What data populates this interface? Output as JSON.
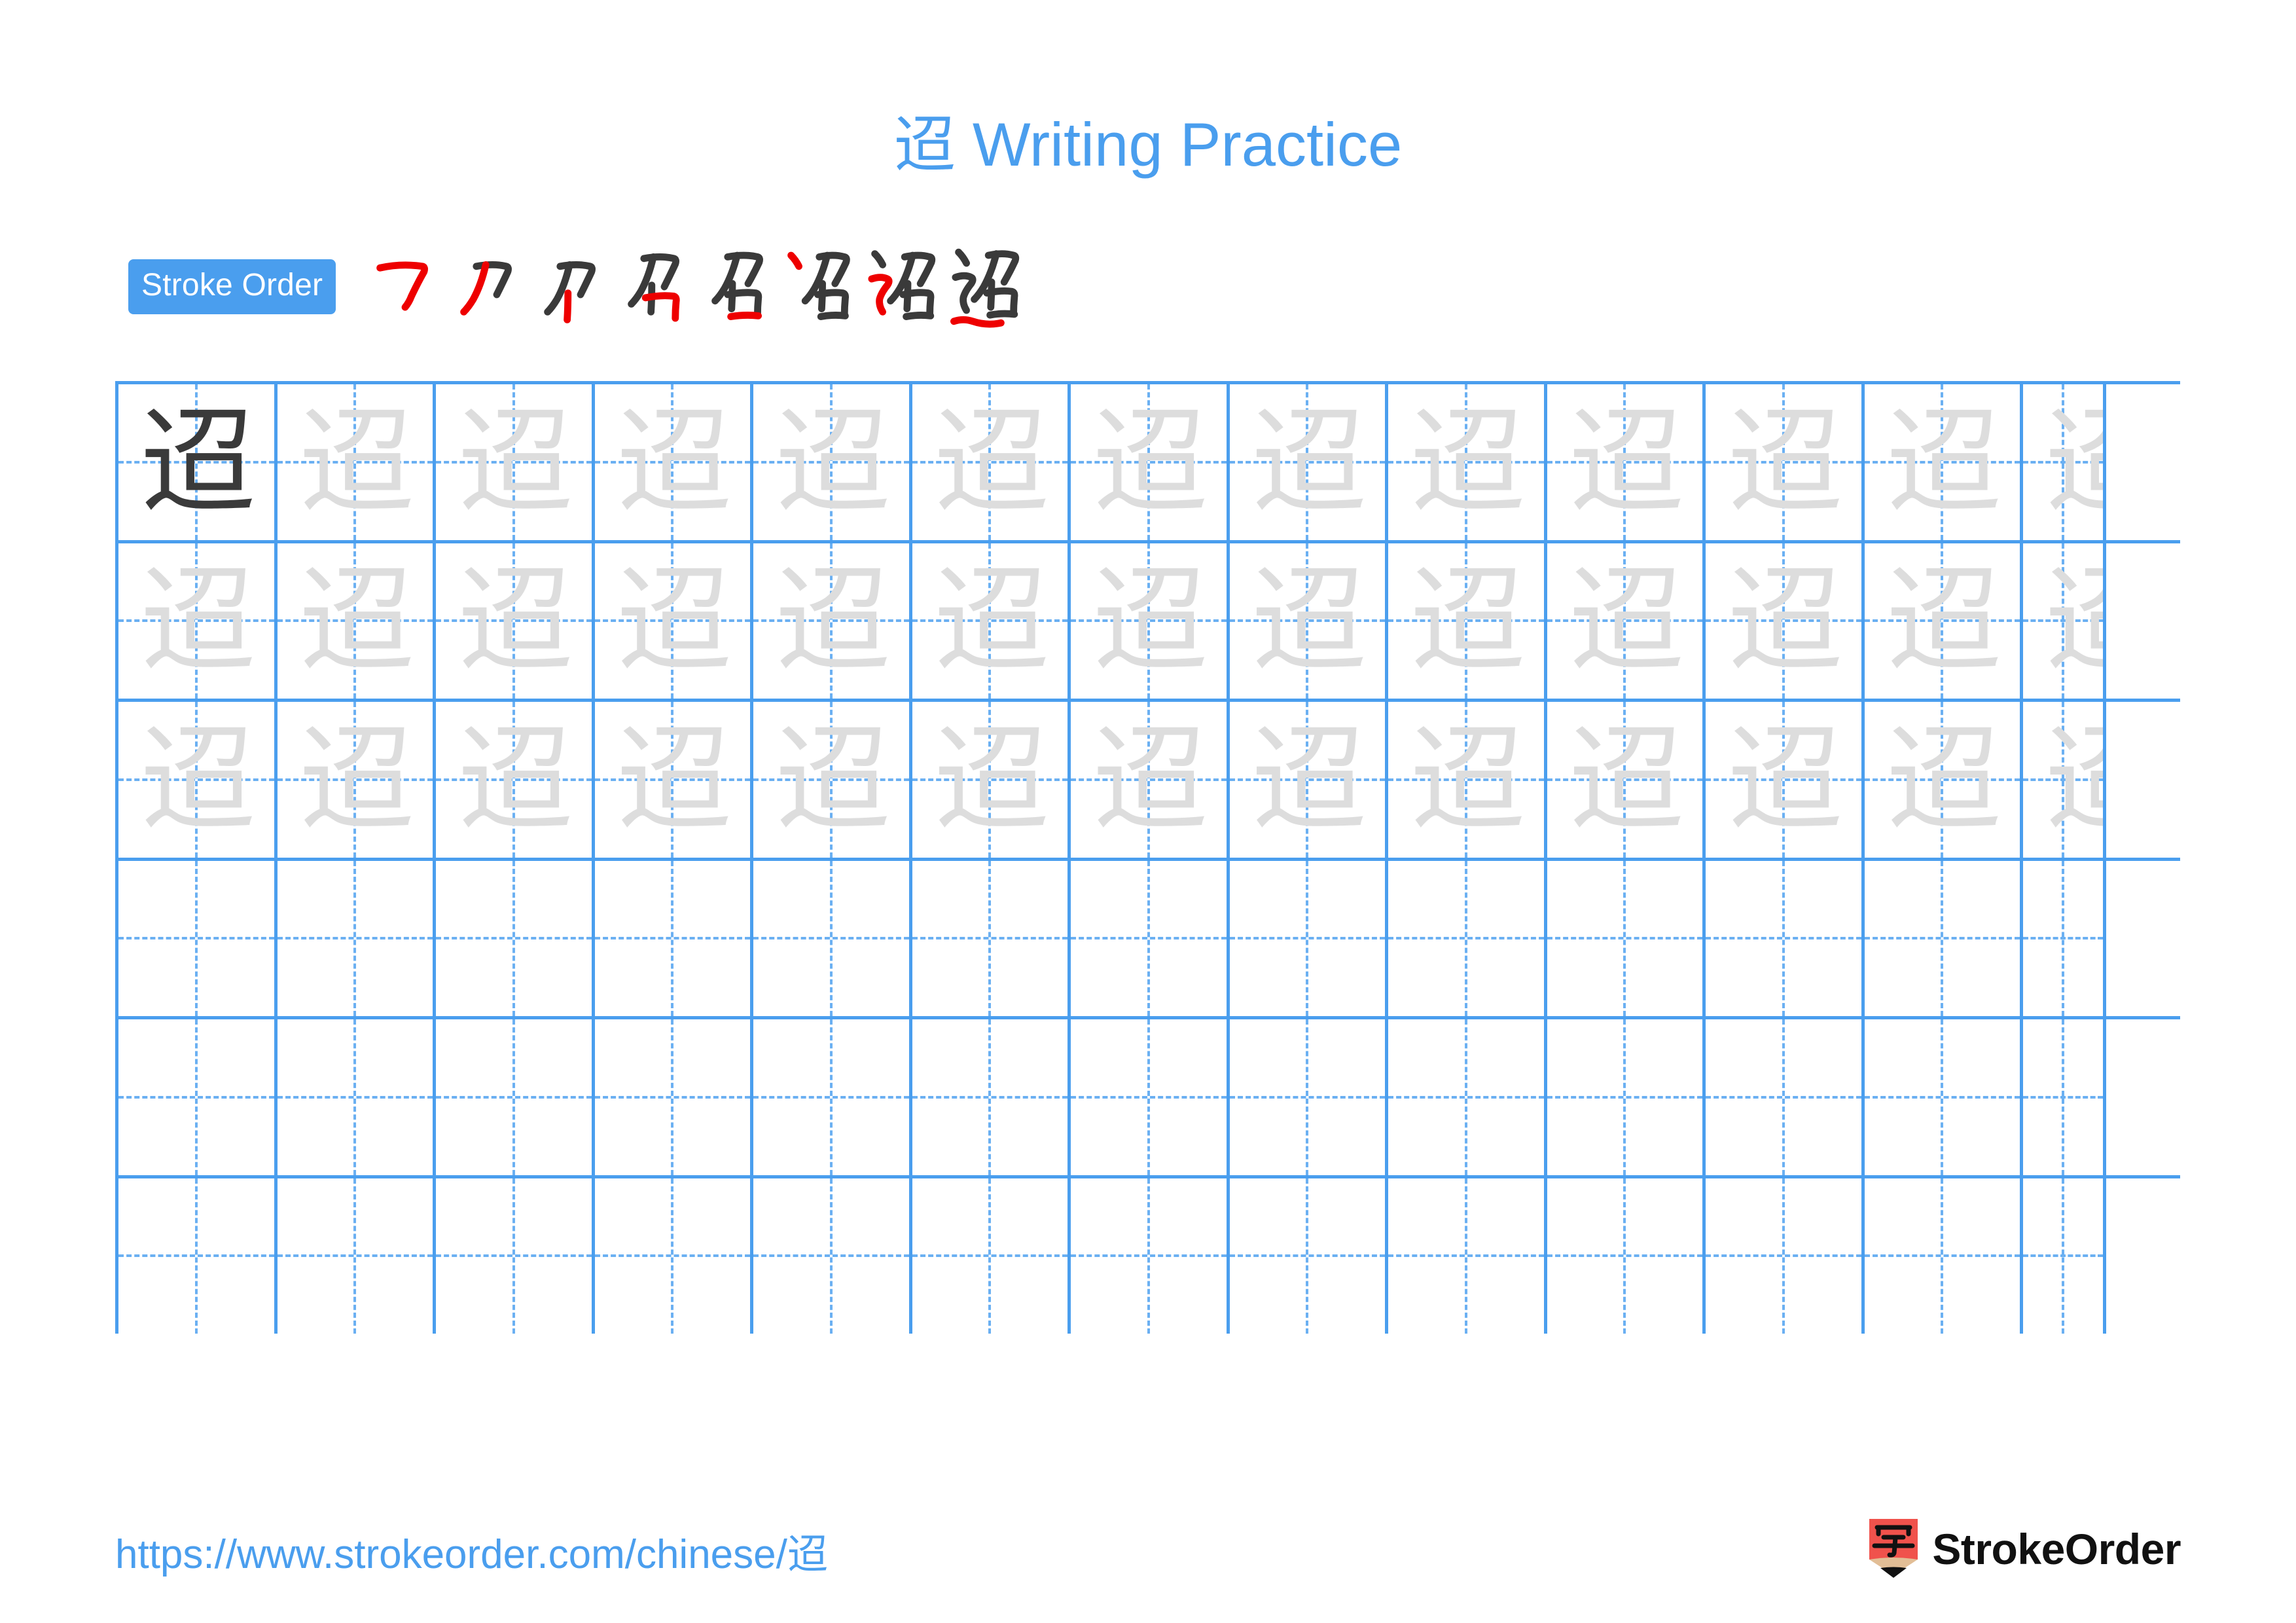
{
  "character": "迢",
  "title": {
    "character": "迢",
    "suffix": " Writing Practice",
    "color": "#4A9EEE"
  },
  "stroke_order": {
    "badge_label": "Stroke Order",
    "badge_bg": "#4A9EEE",
    "badge_text_color": "#FFFFFF",
    "new_stroke_color": "#EE0000",
    "existing_stroke_color": "#3A3A3A",
    "step_count": 8,
    "steps": [
      {
        "index": 1,
        "partial": "マ"
      },
      {
        "index": 2,
        "partial": "刀"
      },
      {
        "index": 3,
        "partial": "刃"
      },
      {
        "index": 4,
        "partial": "召"
      },
      {
        "index": 5,
        "partial": "召"
      },
      {
        "index": 6,
        "partial": "召"
      },
      {
        "index": 7,
        "partial": "迢"
      },
      {
        "index": 8,
        "partial": "迢"
      }
    ]
  },
  "practice_grid": {
    "columns": 13,
    "rows": 6,
    "last_column_clipped": true,
    "grid_line_color": "#4A9EEE",
    "guide_line_color": "#6BB0F2",
    "model_char_color": "#3A3A3A",
    "trace_char_color": "#DDDDDD",
    "row_modes": [
      "model-then-trace",
      "trace",
      "trace",
      "empty",
      "empty",
      "empty"
    ]
  },
  "footer": {
    "url": "https://www.strokeorder.com/chinese/迢",
    "url_color": "#4A9EEE",
    "brand_name": "StrokeOrder",
    "brand_mark_char": "字",
    "brand_mark_color": "#F0524C",
    "brand_mark_wood_color": "#E2BE96",
    "brand_mark_tip_color": "#111111"
  }
}
